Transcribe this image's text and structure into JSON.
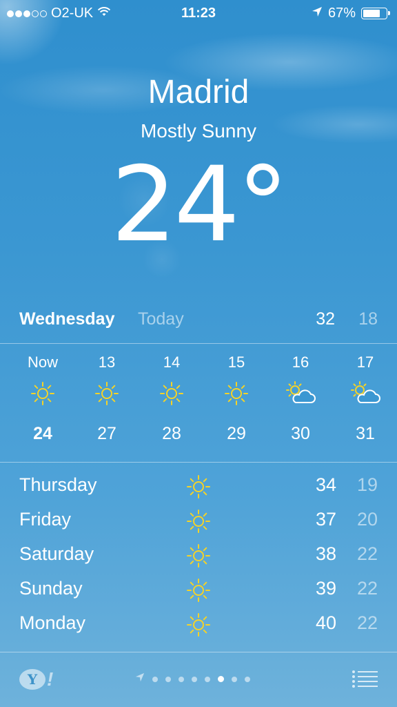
{
  "status_bar": {
    "carrier": "O2-UK",
    "time": "11:23",
    "battery_percent": "67%",
    "signal_strength": 3,
    "signal_max": 5,
    "battery_level": 0.67
  },
  "location": {
    "city": "Madrid",
    "condition": "Mostly Sunny",
    "temperature": "24",
    "degree_symbol": "°"
  },
  "today": {
    "day": "Wednesday",
    "label": "Today",
    "high": "32",
    "low": "18"
  },
  "hourly": [
    {
      "hour": "Now",
      "icon": "sun-icon",
      "temp": "24"
    },
    {
      "hour": "13",
      "icon": "sun-icon",
      "temp": "27"
    },
    {
      "hour": "14",
      "icon": "sun-icon",
      "temp": "28"
    },
    {
      "hour": "15",
      "icon": "sun-icon",
      "temp": "29"
    },
    {
      "hour": "16",
      "icon": "partly-cloudy-icon",
      "temp": "30"
    },
    {
      "hour": "17",
      "icon": "partly-cloudy-icon",
      "temp": "31"
    }
  ],
  "daily": [
    {
      "day": "Thursday",
      "icon": "sun-icon",
      "high": "34",
      "low": "19"
    },
    {
      "day": "Friday",
      "icon": "sun-icon",
      "high": "37",
      "low": "20"
    },
    {
      "day": "Saturday",
      "icon": "sun-icon",
      "high": "38",
      "low": "22"
    },
    {
      "day": "Sunday",
      "icon": "sun-icon",
      "high": "39",
      "low": "22"
    },
    {
      "day": "Monday",
      "icon": "sun-icon",
      "high": "40",
      "low": "22"
    }
  ],
  "footer": {
    "logo_letter": "Y",
    "logo_mark": "!",
    "page_count": 8,
    "active_page": 6
  },
  "colors": {
    "sun": "#f5d327",
    "background_top": "#2f8fce",
    "background_bottom": "#6eb2db"
  }
}
